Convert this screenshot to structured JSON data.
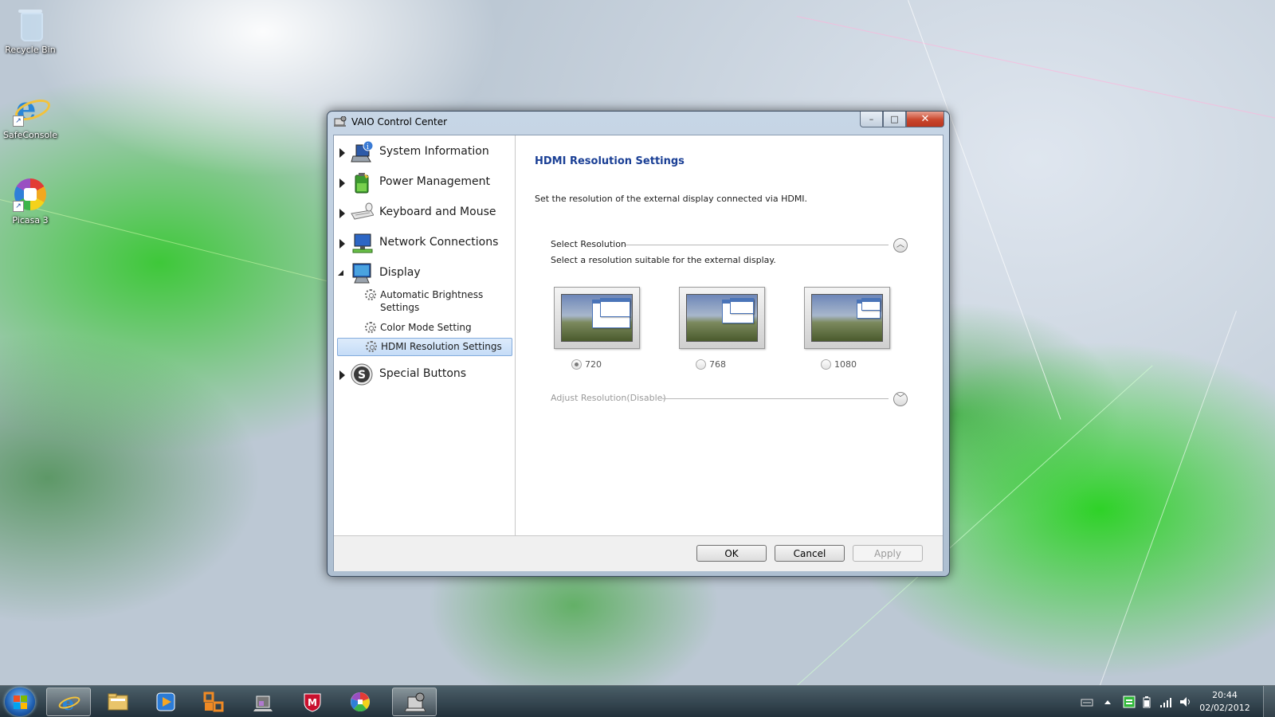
{
  "desktop": {
    "icons": [
      {
        "label": "Recycle Bin"
      },
      {
        "label": "SafeConsole"
      },
      {
        "label": "Picasa 3"
      }
    ]
  },
  "window": {
    "title": "VAIO Control Center",
    "controls": {
      "minimize": "–",
      "maximize": "□",
      "close": "✕"
    }
  },
  "tree": {
    "items": [
      {
        "label": "System Information",
        "icon": "laptop-info-icon"
      },
      {
        "label": "Power Management",
        "icon": "battery-icon"
      },
      {
        "label": "Keyboard and Mouse",
        "icon": "keyboard-icon"
      },
      {
        "label": "Network Connections",
        "icon": "network-icon"
      },
      {
        "label": "Display",
        "icon": "monitor-icon"
      },
      {
        "label": "Special Buttons",
        "icon": "s-button-icon"
      }
    ],
    "display_children": [
      {
        "label": "Automatic Brightness Settings"
      },
      {
        "label": "Color Mode Setting"
      },
      {
        "label": "HDMI Resolution Settings"
      }
    ],
    "selected": "HDMI Resolution Settings"
  },
  "content": {
    "title": "HDMI Resolution Settings",
    "description": "Set the resolution of the external display connected via HDMI.",
    "select_section": {
      "label": "Select Resolution",
      "subtitle": "Select a resolution suitable for the external display.",
      "options": [
        "720",
        "768",
        "1080"
      ],
      "selected": "720"
    },
    "adjust_section": {
      "label": "Adjust Resolution(Disable)"
    }
  },
  "footer": {
    "ok": "OK",
    "cancel": "Cancel",
    "apply": "Apply"
  },
  "taskbar": {
    "buttons": [
      "internet-explorer-icon",
      "explorer-folder-icon",
      "media-player-icon",
      "office-icon",
      "vaio-tool-icon",
      "mcafee-icon",
      "picasa-icon",
      "vaio-control-center-icon"
    ],
    "time": "20:44",
    "date": "02/02/2012"
  },
  "colors": {
    "title_blue": "#1a3f95",
    "selection": "#c5dcf7"
  }
}
